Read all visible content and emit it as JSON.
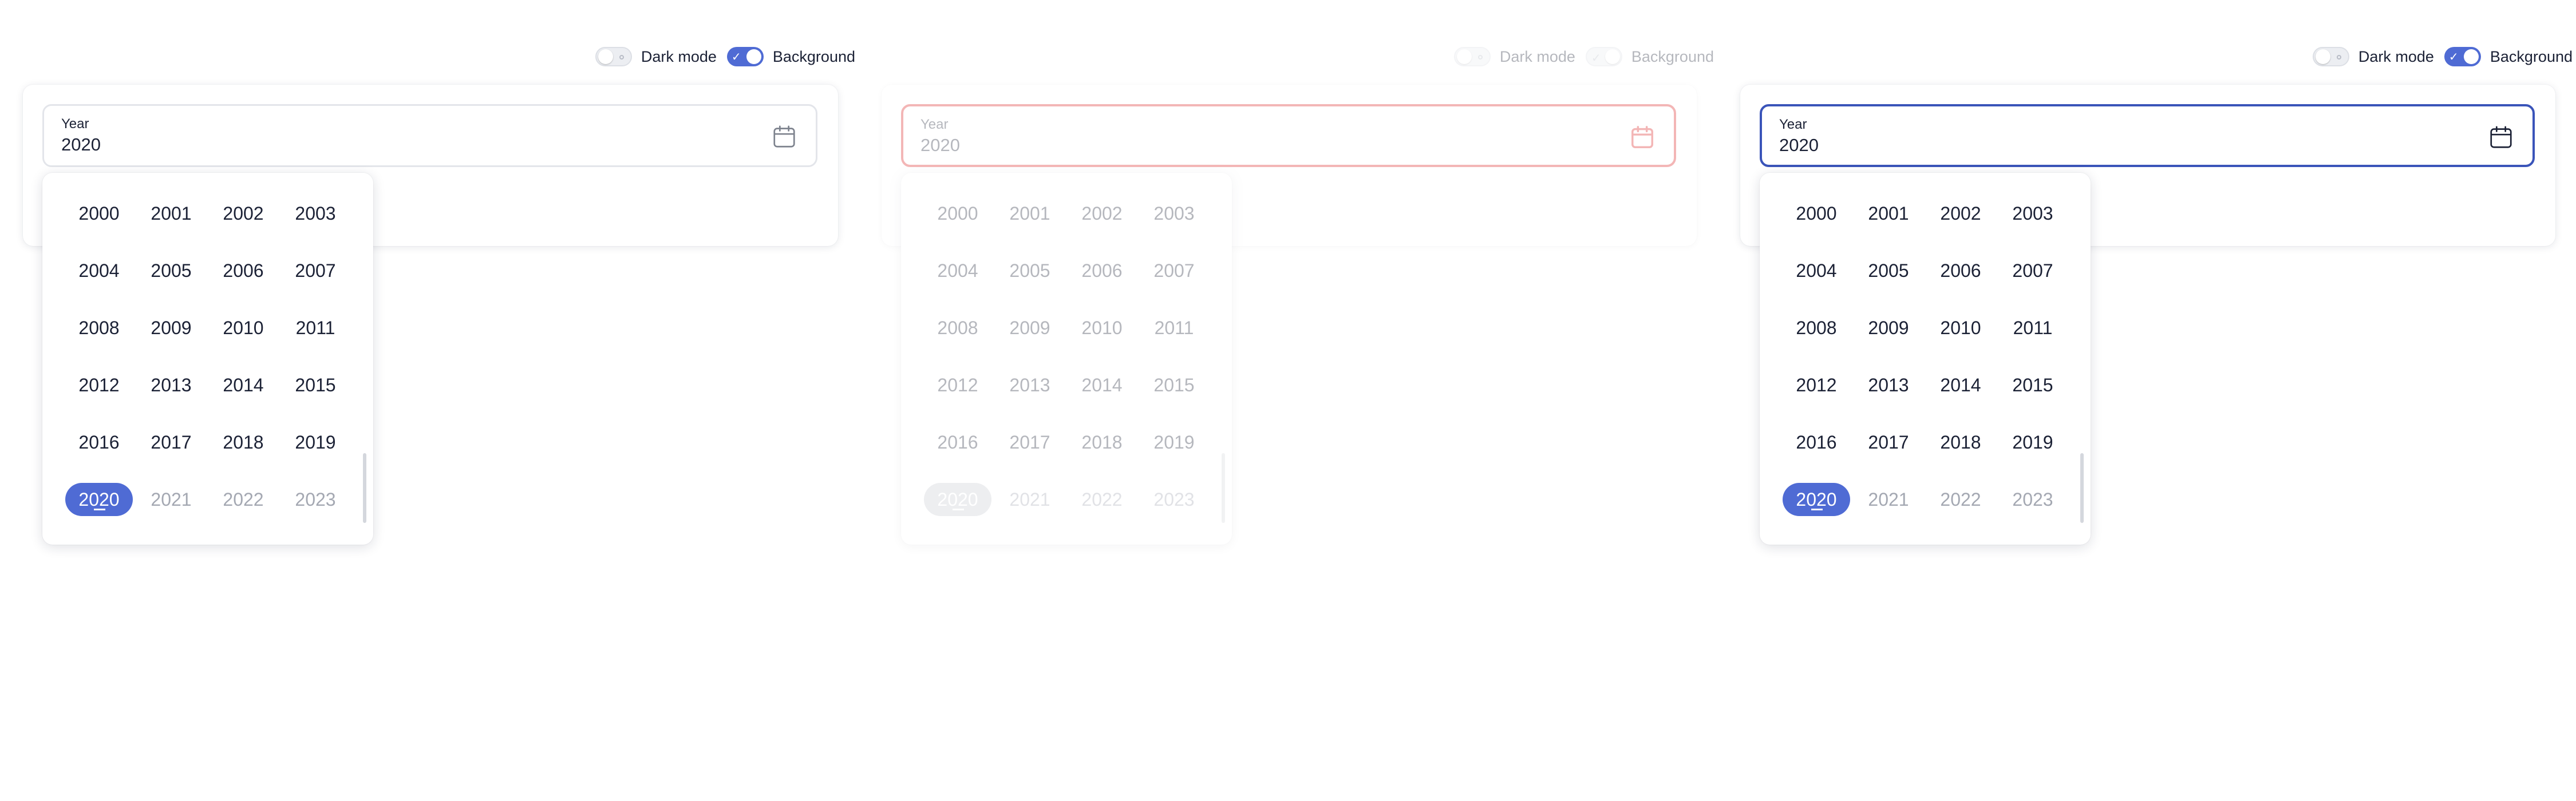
{
  "panels": [
    {
      "toggles": {
        "dark_mode": "Dark mode",
        "background": "Background"
      },
      "field": {
        "label": "Year",
        "value": "2020",
        "state": "default"
      },
      "years": [
        "2000",
        "2001",
        "2002",
        "2003",
        "2004",
        "2005",
        "2006",
        "2007",
        "2008",
        "2009",
        "2010",
        "2011",
        "2012",
        "2013",
        "2014",
        "2015",
        "2016",
        "2017",
        "2018",
        "2019",
        "2020",
        "2021",
        "2022",
        "2023"
      ],
      "selected_year": "2020"
    },
    {
      "toggles": {
        "dark_mode": "Dark mode",
        "background": "Background"
      },
      "field": {
        "label": "Year",
        "value": "2020",
        "state": "error"
      },
      "years": [
        "2000",
        "2001",
        "2002",
        "2003",
        "2004",
        "2005",
        "2006",
        "2007",
        "2008",
        "2009",
        "2010",
        "2011",
        "2012",
        "2013",
        "2014",
        "2015",
        "2016",
        "2017",
        "2018",
        "2019",
        "2020",
        "2021",
        "2022",
        "2023"
      ],
      "selected_year": "2020"
    },
    {
      "toggles": {
        "dark_mode": "Dark mode",
        "background": "Background"
      },
      "field": {
        "label": "Year",
        "value": "2020",
        "state": "focused"
      },
      "years": [
        "2000",
        "2001",
        "2002",
        "2003",
        "2004",
        "2005",
        "2006",
        "2007",
        "2008",
        "2009",
        "2010",
        "2011",
        "2012",
        "2013",
        "2014",
        "2015",
        "2016",
        "2017",
        "2018",
        "2019",
        "2020",
        "2021",
        "2022",
        "2023"
      ],
      "selected_year": "2020"
    }
  ],
  "icons": {
    "calendar": "calendar-icon",
    "check": "check-icon"
  },
  "colors": {
    "accent": "#4f6bd4",
    "error": "#dd1f1f",
    "focus": "#3a54b9",
    "text": "#1b2135",
    "muted": "#a4a8b2"
  }
}
